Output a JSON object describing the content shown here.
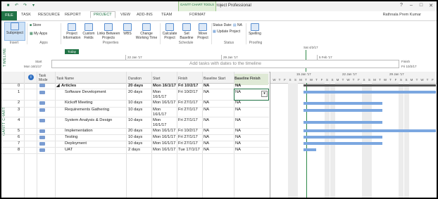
{
  "app": {
    "title": "Articles.mpp - Project Professional",
    "context_tab_group": "GANTT CHART TOOLS",
    "user": "Rathnala Prem Kumar"
  },
  "tabs": [
    {
      "label": "FILE"
    },
    {
      "label": "TASK"
    },
    {
      "label": "RESOURCE"
    },
    {
      "label": "REPORT"
    },
    {
      "label": "PROJECT"
    },
    {
      "label": "VIEW"
    },
    {
      "label": "ADD-INS"
    },
    {
      "label": "TEAM"
    },
    {
      "label": "FORMAT"
    }
  ],
  "ribbon": {
    "subproject": "Subproject",
    "store": "Store",
    "my_apps": "My Apps",
    "project_information": "Project Information",
    "custom_fields": "Custom Fields",
    "links_between_projects": "Links Between Projects",
    "wbs": "WBS",
    "change_working_time": "Change Working Time",
    "calculate_project": "Calculate Project",
    "set_baseline": "Set Baseline",
    "move_project": "Move Project",
    "status_date_label": "Status Date:",
    "status_date_value": "NA",
    "update_project": "Update Project",
    "spelling": "Spelling",
    "groups": [
      "Insert",
      "Apps",
      "Properties",
      "Schedule",
      "Status",
      "Proofing"
    ]
  },
  "timeline": {
    "side_label": "TIMELINE",
    "today": "Today",
    "start_label": "Start",
    "start_date": "Mon 16/1/17",
    "finish_label": "Finish",
    "finish_date": "Fri 10/2/17",
    "marker": "Sat 4/2/17",
    "ticks": [
      "22 Jan '17",
      "29 Jan '17",
      "5 Feb '17"
    ],
    "placeholder": "Add tasks with dates to the timeline"
  },
  "grid": {
    "side_label": "GANTT CHART",
    "headers": {
      "id": "",
      "task_mode": "Task Mode",
      "task_name": "Task Name",
      "duration": "Duration",
      "start": "Start",
      "finish": "Finish",
      "baseline_start": "Baseline Start",
      "baseline_finish": "Baseline Finish"
    },
    "rows": [
      {
        "id": "0",
        "name": "Articles",
        "duration": "20 days",
        "start": "Mon 16/1/17",
        "finish": "Fri 10/2/17",
        "baseline_start": "NA",
        "baseline_finish": "NA"
      },
      {
        "id": "1",
        "name": "Software Development",
        "duration": "20 days",
        "start": "Mon 16/1/17",
        "finish": "Fri 10/2/17",
        "baseline_start": "NA",
        "baseline_finish": "NA"
      },
      {
        "id": "2",
        "name": "Kickoff Meeting",
        "duration": "10 days",
        "start": "Mon 16/1/17",
        "finish": "Fri 27/1/17",
        "baseline_start": "NA",
        "baseline_finish": "NA"
      },
      {
        "id": "3",
        "name": "Requirements Gathering",
        "duration": "10 days",
        "start": "Mon 16/1/17",
        "finish": "Fri 27/1/17",
        "baseline_start": "NA",
        "baseline_finish": "NA"
      },
      {
        "id": "4",
        "name": "System Analysis & Design",
        "duration": "10 days",
        "start": "Mon 16/1/17",
        "finish": "Fri 27/1/17",
        "baseline_start": "NA",
        "baseline_finish": "NA"
      },
      {
        "id": "5",
        "name": "Implementation",
        "duration": "20 days",
        "start": "Mon 16/1/17",
        "finish": "Fri 10/2/17",
        "baseline_start": "NA",
        "baseline_finish": "NA"
      },
      {
        "id": "6",
        "name": "Testing",
        "duration": "10 days",
        "start": "Mon 16/1/17",
        "finish": "Fri 27/1/17",
        "baseline_start": "NA",
        "baseline_finish": "NA"
      },
      {
        "id": "7",
        "name": "Deployment",
        "duration": "10 days",
        "start": "Mon 16/1/17",
        "finish": "Fri 27/1/17",
        "baseline_start": "NA",
        "baseline_finish": "NA"
      },
      {
        "id": "8",
        "name": "UAT",
        "duration": "2 days",
        "start": "Mon 16/1/17",
        "finish": "Tue 17/1/17",
        "baseline_start": "NA",
        "baseline_finish": "NA"
      }
    ]
  },
  "chart": {
    "weeks": [
      "15 Jan '17",
      "22 Jan '17",
      "29 Jan '17"
    ],
    "days": [
      "W",
      "T",
      "F",
      "S",
      "S",
      "M",
      "T",
      "W",
      "T",
      "F",
      "S",
      "S",
      "M",
      "T",
      "W",
      "T",
      "F",
      "S",
      "S",
      "M",
      "T",
      "W",
      "T",
      "F",
      "S",
      "S",
      "M",
      "T",
      "W",
      "T",
      "F"
    ]
  },
  "colors": {
    "brand": "#217346",
    "gantt_bar": "#7ba7e0",
    "summary_bar": "#555555"
  }
}
